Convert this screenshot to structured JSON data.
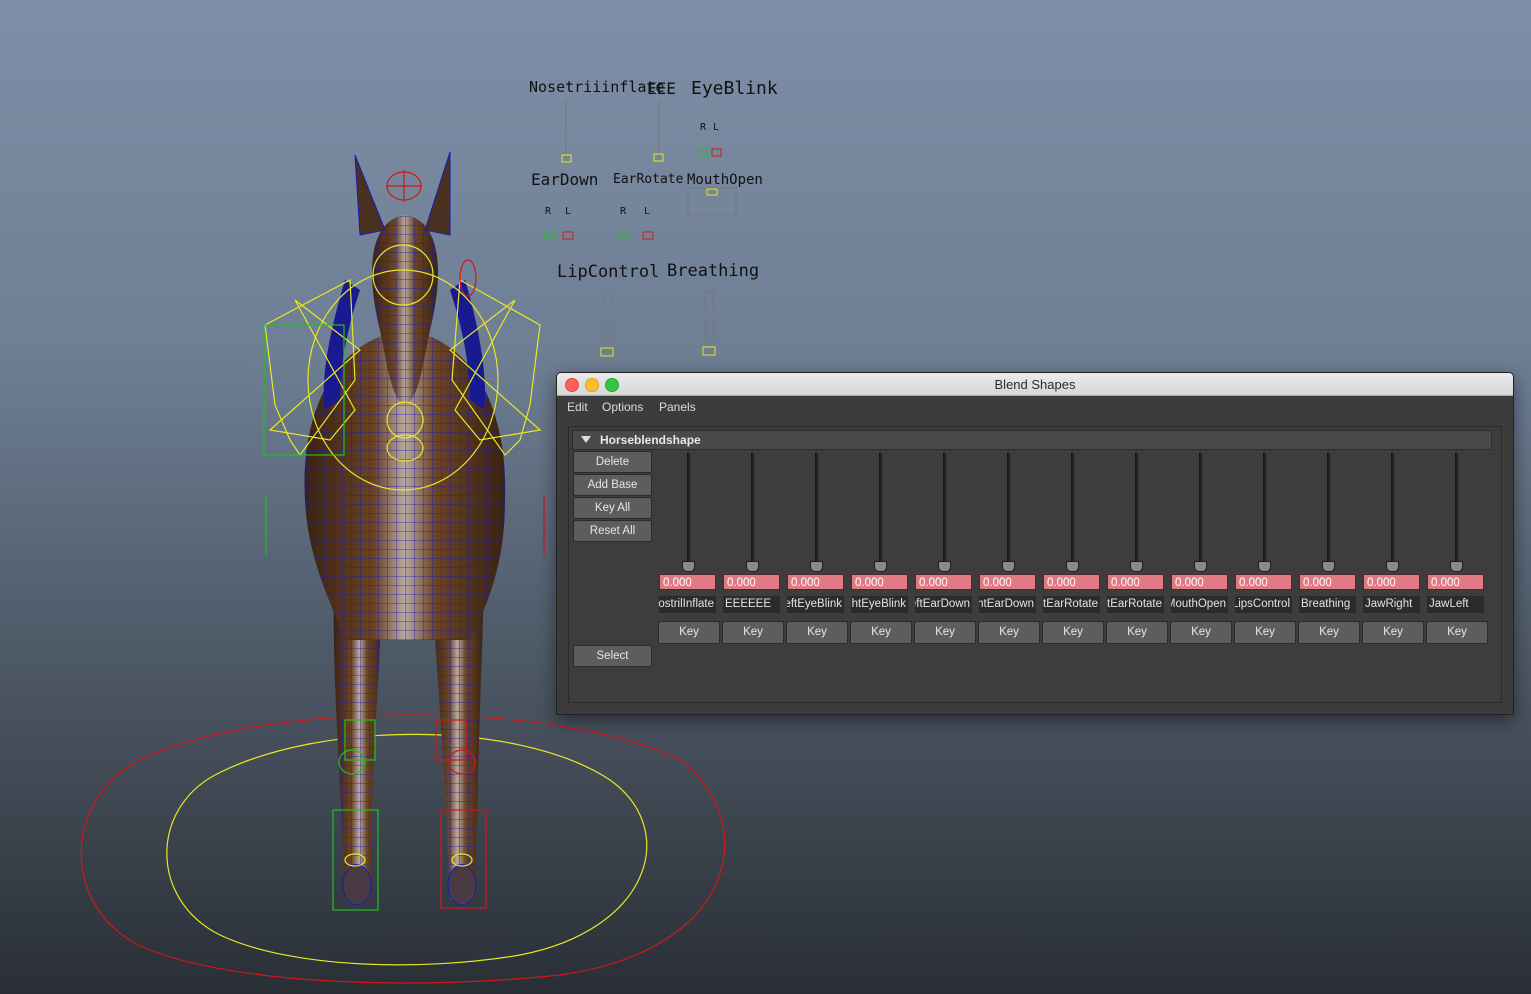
{
  "viewport": {
    "controls": {
      "nostril_inflate": "Nosetriiinflate",
      "eee": "EEE",
      "eye_blink": "EyeBlink",
      "ear_down": "EarDown",
      "ear_rotate": "EarRotate",
      "mouth_open": "MouthOpen",
      "lip_control": "LipControl",
      "breathing": "Breathing",
      "r": "R",
      "l": "L"
    }
  },
  "window": {
    "title": "Blend Shapes",
    "traffic_colors": [
      "#fc5f57",
      "#fdbc2e",
      "#33c748"
    ],
    "menu": [
      "Edit",
      "Options",
      "Panels"
    ],
    "section_title": "Horseblendshape",
    "side_buttons": {
      "delete": "Delete",
      "add_base": "Add Base",
      "key_all": "Key All",
      "reset_all": "Reset All",
      "select": "Select"
    },
    "targets": [
      {
        "value": "0.000",
        "name": "NostrilInflate",
        "key": "Key"
      },
      {
        "value": "0.000",
        "name": "EEEEEE",
        "key": "Key"
      },
      {
        "value": "0.000",
        "name": "LeftEyeBlink",
        "key": "Key"
      },
      {
        "value": "0.000",
        "name": "RightEyeBlink",
        "key": "Key"
      },
      {
        "value": "0.000",
        "name": "LeftEarDown",
        "key": "Key"
      },
      {
        "value": "0.000",
        "name": "RightEarDown",
        "key": "Key"
      },
      {
        "value": "0.000",
        "name": "LeftEarRotate",
        "key": "Key"
      },
      {
        "value": "0.000",
        "name": "RightEarRotate",
        "key": "Key"
      },
      {
        "value": "0.000",
        "name": "MouthOpen",
        "key": "Key"
      },
      {
        "value": "0.000",
        "name": "LipsControl",
        "key": "Key"
      },
      {
        "value": "0.000",
        "name": "Breathing",
        "key": "Key"
      },
      {
        "value": "0.000",
        "name": "JawRight",
        "key": "Key"
      },
      {
        "value": "0.000",
        "name": "JawLeft",
        "key": "Key"
      }
    ]
  }
}
